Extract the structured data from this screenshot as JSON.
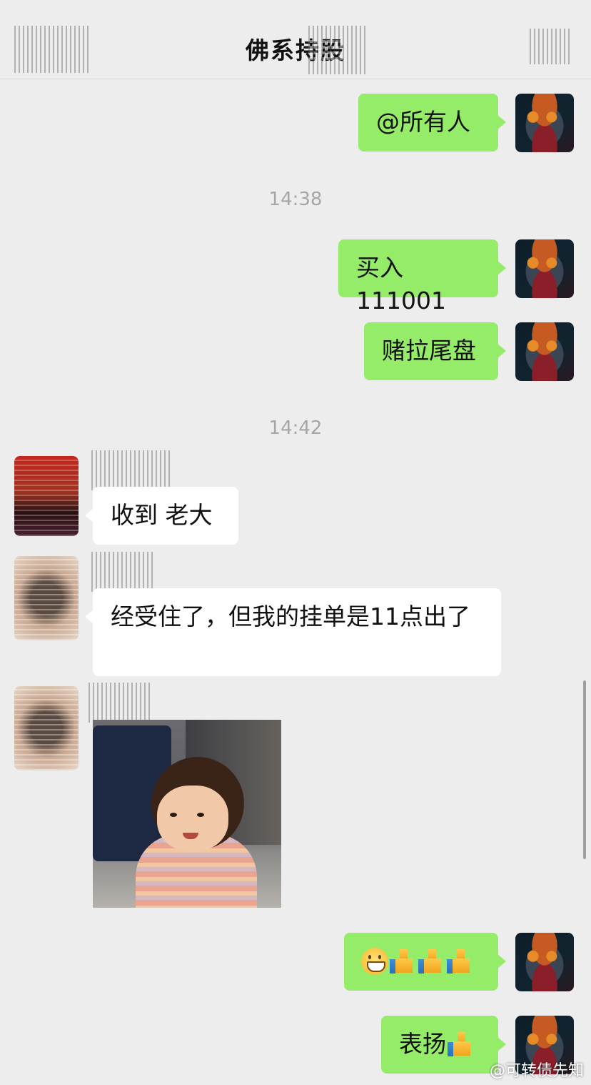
{
  "header": {
    "title": "佛系持股"
  },
  "messages": [
    {
      "side": "mine",
      "text": "@所有人"
    },
    {
      "type": "time",
      "text": "14:38"
    },
    {
      "side": "mine",
      "text": "买入 111001"
    },
    {
      "side": "mine",
      "text": "赌拉尾盘"
    },
    {
      "type": "time",
      "text": "14:42"
    },
    {
      "side": "theirs",
      "text": "收到  老大"
    },
    {
      "side": "theirs",
      "text": "经受住了，但我的挂单是11点出了"
    },
    {
      "side": "theirs",
      "type": "image",
      "description_icon": "photo-icon"
    },
    {
      "side": "mine",
      "emoji": [
        "grinning-face-icon",
        "thumbs-up-icon",
        "thumbs-up-icon",
        "thumbs-up-icon"
      ]
    },
    {
      "side": "mine",
      "text": "表扬",
      "emoji": [
        "thumbs-up-icon"
      ]
    }
  ],
  "watermark": "@可转债先知"
}
